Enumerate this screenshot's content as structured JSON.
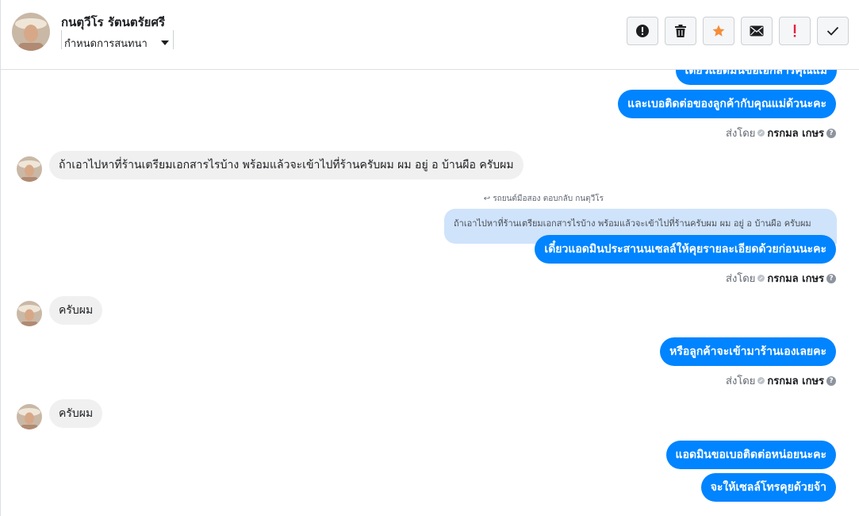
{
  "header": {
    "contact_name": "กนตุวีโร รัตนตรัยศรี",
    "assign_label": "กำหนดการสนทนา",
    "toolbar": [
      {
        "name": "alert-circle-icon",
        "title": "!"
      },
      {
        "name": "trash-icon",
        "title": ""
      },
      {
        "name": "star-icon",
        "title": ""
      },
      {
        "name": "envelope-icon",
        "title": ""
      },
      {
        "name": "exclamation-icon",
        "title": "!"
      },
      {
        "name": "check-icon",
        "title": ""
      }
    ],
    "colors": {
      "star": "#f48d3a",
      "exclamation": "#e41e3f"
    }
  },
  "messages": {
    "m0_partial": "เดี๋ยวแอดมินขอเอกสารคุณแม่",
    "m1": "และเบอติดต่อของลูกค้ากับคุณแม่ด้วนะคะ",
    "m2": "ถ้าเอาไปหาที่ร้านเตรียมเอกสารไรบ้าง พร้อมแล้วจะเข้าไปที่ร้านครับผม  ผม อยู่ อ บ้านผือ ครับผม",
    "reply_note": "รถยนต์มือสอง ตอบกลับ กนตุวีโร",
    "quote": "ถ้าเอาไปหาที่ร้านเตรียมเอกสารไรบ้าง พร้อมแล้วจะเข้าไปที่ร้านครับผม ผม อยู่ อ บ้านผือ ครับผม",
    "m3": "เดี๋ยวแอดมินประสานนเซลล์ให้คุยรายละเอียดด้วยก่อนนะคะ",
    "m4": "ครับผม",
    "m5": "หรือลูกค้าจะเข้ามาร้านเองเลยคะ",
    "m6": "ครับผม",
    "m7": "แอดมินขอเบอติดต่อหน่อยนะคะ",
    "m8": "จะให้เซลล์โทรคุยด้วยจ้า"
  },
  "sent_by": {
    "prefix": "ส่งโดย",
    "name": "กรกมล เกษร"
  },
  "colors": {
    "outgoing_bubble": "#0084ff",
    "incoming_bubble": "#f0f0f0",
    "quote_bubble": "#cfe3fb"
  }
}
